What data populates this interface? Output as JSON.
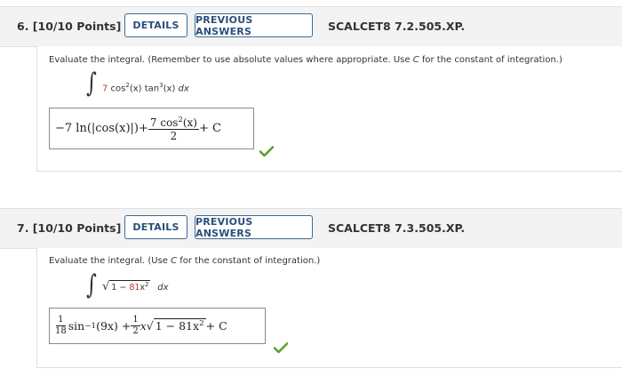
{
  "q6": {
    "title": "6.  [10/10 Points]",
    "details_label": "DETAILS",
    "prev_label": "PREVIOUS ANSWERS",
    "code": "SCALCET8 7.2.505.XP.",
    "prompt_before": "Evaluate the integral. (Remember to use absolute values where appropriate. Use ",
    "prompt_var": "C",
    "prompt_after": " for the constant of integration.)",
    "integrand_coef": "7",
    "integrand_body": " cos",
    "integrand_sup1": "2",
    "integrand_mid": "(x) tan",
    "integrand_sup2": "3",
    "integrand_end": "(x) ",
    "integrand_dx": "dx",
    "answer_part1": "−7 ln",
    "answer_abs": "(|cos(x)|)",
    "answer_plus1": " + ",
    "answer_num_a": "7 cos",
    "answer_num_sup": "2",
    "answer_num_b": "(x)",
    "answer_den": "2",
    "answer_plus2": " + C"
  },
  "q7": {
    "title": "7.  [10/10 Points]",
    "details_label": "DETAILS",
    "prev_label": "PREVIOUS ANSWERS",
    "code": "SCALCET8 7.3.505.XP.",
    "prompt_before": "Evaluate the integral. (Use ",
    "prompt_var": "C",
    "prompt_after": " for the constant of integration.)",
    "root_a": "1 − ",
    "root_coef": "81",
    "root_x": "x",
    "root_sup": "2",
    "integrand_dx": "dx",
    "ans_f1_num": "1",
    "ans_f1_den": "18",
    "ans_sin": "sin",
    "ans_sin_sup": "−1",
    "ans_arg": "(9x) + ",
    "ans_f2_num": "1",
    "ans_f2_den": "2",
    "ans_x": "x",
    "ans_root": "1 − 81x",
    "ans_root_sup": "2",
    "ans_plus": " + C"
  },
  "colors": {
    "button_border": "#3d6a94",
    "correct": "#5aa02c",
    "coef_red": "#c0392b"
  },
  "icons": {
    "check": "checkmark-icon",
    "radical": "square-root-symbol"
  }
}
